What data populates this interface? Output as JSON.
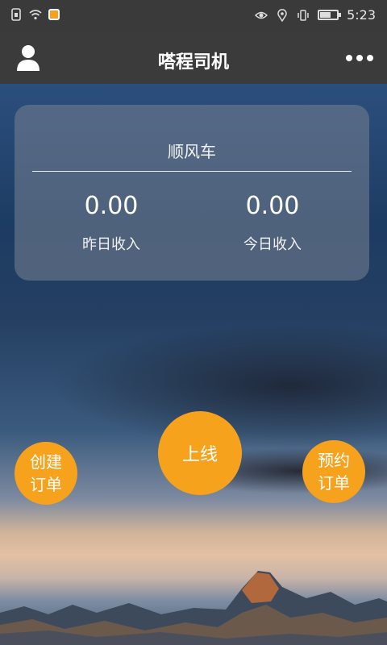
{
  "statusbar": {
    "time": "5:23",
    "battery_level": 0.7
  },
  "header": {
    "title": "嗒程司机",
    "avatar_icon": "person-icon",
    "more_icon": "more-dots-icon"
  },
  "card": {
    "title": "顺风车",
    "yesterday": {
      "value": "0.00",
      "label": "昨日收入"
    },
    "today": {
      "value": "0.00",
      "label": "今日收入"
    }
  },
  "buttons": {
    "create_order": "创建订单",
    "go_online": "上线",
    "reserve_order": "预约订单"
  },
  "colors": {
    "accent": "#f6a21d",
    "header": "#3b3b3b",
    "statusbar": "#3a3a3a"
  }
}
